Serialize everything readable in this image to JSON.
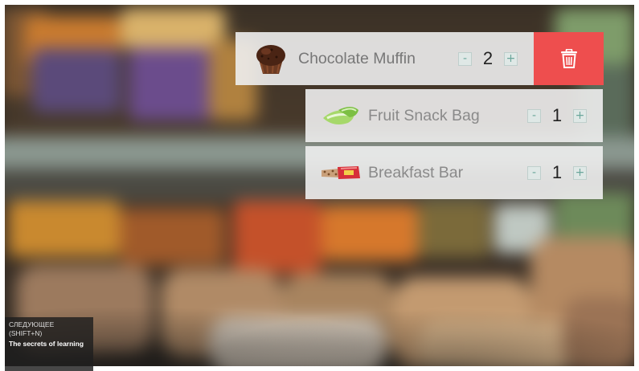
{
  "cart": {
    "items": [
      {
        "name": "Chocolate Muffin",
        "quantity": "2",
        "decrement_label": "-",
        "increment_label": "+",
        "thumb_icon": "chocolate-muffin-icon"
      },
      {
        "name": "Fruit Snack Bag",
        "quantity": "1",
        "decrement_label": "-",
        "increment_label": "+",
        "thumb_icon": "fruit-snack-icon"
      },
      {
        "name": "Breakfast Bar",
        "quantity": "1",
        "decrement_label": "-",
        "increment_label": "+",
        "thumb_icon": "breakfast-bar-icon"
      }
    ],
    "delete_icon": "trash-icon",
    "delete_color": "#ee4e4e"
  },
  "next_video": {
    "heading": "СЛЕДУЮЩЕЕ",
    "shortcut": "(SHIFT+N)",
    "title": "The secrets of learning"
  }
}
